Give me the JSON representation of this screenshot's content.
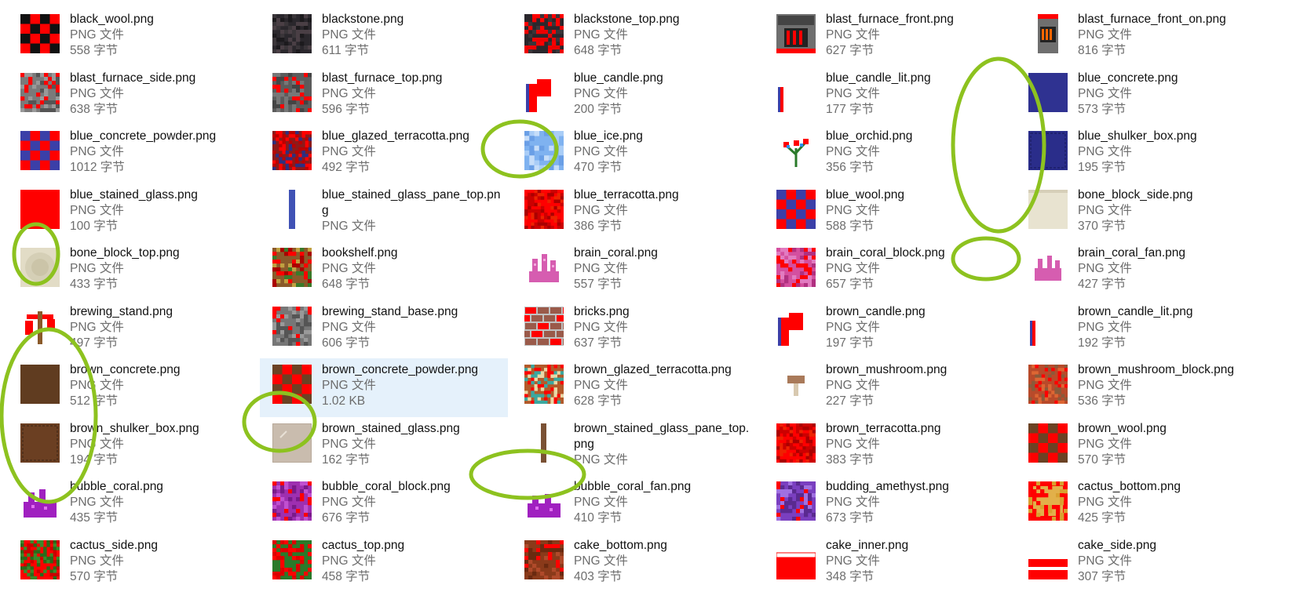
{
  "files": [
    {
      "name": "black_wool.png",
      "type": "PNG 文件",
      "size": "558 字节",
      "icon": "checker-red-black-texture"
    },
    {
      "name": "blackstone.png",
      "type": "PNG 文件",
      "size": "611 字节",
      "icon": "dark-stone-texture"
    },
    {
      "name": "blackstone_top.png",
      "type": "PNG 文件",
      "size": "648 字节",
      "icon": "dark-stone-red-texture"
    },
    {
      "name": "blast_furnace_front.png",
      "type": "PNG 文件",
      "size": "627 字节",
      "icon": "furnace-front-texture"
    },
    {
      "name": "blast_furnace_front_on.png",
      "type": "PNG 文件",
      "size": "816 字节",
      "icon": "furnace-front-on-texture"
    },
    {
      "name": "blast_furnace_side.png",
      "type": "PNG 文件",
      "size": "638 字节",
      "icon": "furnace-side-texture"
    },
    {
      "name": "blast_furnace_top.png",
      "type": "PNG 文件",
      "size": "596 字节",
      "icon": "furnace-top-texture"
    },
    {
      "name": "blue_candle.png",
      "type": "PNG 文件",
      "size": "200 字节",
      "icon": "candle-texture"
    },
    {
      "name": "blue_candle_lit.png",
      "type": "PNG 文件",
      "size": "177 字节",
      "icon": "candle-lit-texture"
    },
    {
      "name": "blue_concrete.png",
      "type": "PNG 文件",
      "size": "573 字节",
      "icon": "solid-blue-texture"
    },
    {
      "name": "blue_concrete_powder.png",
      "type": "PNG 文件",
      "size": "1012 字节",
      "icon": "checker-red-blue-texture"
    },
    {
      "name": "blue_glazed_terracotta.png",
      "type": "PNG 文件",
      "size": "492 字节",
      "icon": "glazed-terracotta-texture"
    },
    {
      "name": "blue_ice.png",
      "type": "PNG 文件",
      "size": "470 字节",
      "icon": "ice-texture"
    },
    {
      "name": "blue_orchid.png",
      "type": "PNG 文件",
      "size": "356 字节",
      "icon": "flower-texture"
    },
    {
      "name": "blue_shulker_box.png",
      "type": "PNG 文件",
      "size": "195 字节",
      "icon": "shulker-blue-texture"
    },
    {
      "name": "blue_stained_glass.png",
      "type": "PNG 文件",
      "size": "100 字节",
      "icon": "solid-red-texture"
    },
    {
      "name": "blue_stained_glass_pane_top.png",
      "type": "PNG 文件",
      "size": "",
      "icon": "glass-pane-blue-texture"
    },
    {
      "name": "blue_terracotta.png",
      "type": "PNG 文件",
      "size": "386 字节",
      "icon": "noise-red-texture"
    },
    {
      "name": "blue_wool.png",
      "type": "PNG 文件",
      "size": "588 字节",
      "icon": "checker-red-blue-texture"
    },
    {
      "name": "bone_block_side.png",
      "type": "PNG 文件",
      "size": "370 字节",
      "icon": "bone-side-texture"
    },
    {
      "name": "bone_block_top.png",
      "type": "PNG 文件",
      "size": "433 字节",
      "icon": "bone-top-texture"
    },
    {
      "name": "bookshelf.png",
      "type": "PNG 文件",
      "size": "648 字节",
      "icon": "bookshelf-texture"
    },
    {
      "name": "brain_coral.png",
      "type": "PNG 文件",
      "size": "557 字节",
      "icon": "coral-pink-texture"
    },
    {
      "name": "brain_coral_block.png",
      "type": "PNG 文件",
      "size": "657 字节",
      "icon": "coral-block-pink-texture"
    },
    {
      "name": "brain_coral_fan.png",
      "type": "PNG 文件",
      "size": "427 字节",
      "icon": "coral-fan-pink-texture"
    },
    {
      "name": "brewing_stand.png",
      "type": "PNG 文件",
      "size": "497 字节",
      "icon": "brewing-stand-texture"
    },
    {
      "name": "brewing_stand_base.png",
      "type": "PNG 文件",
      "size": "606 字节",
      "icon": "stone-red-texture"
    },
    {
      "name": "bricks.png",
      "type": "PNG 文件",
      "size": "637 字节",
      "icon": "bricks-texture"
    },
    {
      "name": "brown_candle.png",
      "type": "PNG 文件",
      "size": "197 字节",
      "icon": "candle-texture"
    },
    {
      "name": "brown_candle_lit.png",
      "type": "PNG 文件",
      "size": "192 字节",
      "icon": "candle-lit-texture"
    },
    {
      "name": "brown_concrete.png",
      "type": "PNG 文件",
      "size": "512 字节",
      "icon": "solid-brown-texture"
    },
    {
      "name": "brown_concrete_powder.png",
      "type": "PNG 文件",
      "size": "1.02 KB",
      "icon": "checker-red-brown-texture"
    },
    {
      "name": "brown_glazed_terracotta.png",
      "type": "PNG 文件",
      "size": "628 字节",
      "icon": "glazed-brown-texture"
    },
    {
      "name": "brown_mushroom.png",
      "type": "PNG 文件",
      "size": "227 字节",
      "icon": "mushroom-texture"
    },
    {
      "name": "brown_mushroom_block.png",
      "type": "PNG 文件",
      "size": "536 字节",
      "icon": "noise-red-brown-texture"
    },
    {
      "name": "brown_shulker_box.png",
      "type": "PNG 文件",
      "size": "194 字节",
      "icon": "shulker-brown-texture"
    },
    {
      "name": "brown_stained_glass.png",
      "type": "PNG 文件",
      "size": "162 字节",
      "icon": "glass-beige-texture"
    },
    {
      "name": "brown_stained_glass_pane_top.png",
      "type": "PNG 文件",
      "size": "",
      "icon": "glass-pane-brown-texture"
    },
    {
      "name": "brown_terracotta.png",
      "type": "PNG 文件",
      "size": "383 字节",
      "icon": "noise-red-texture"
    },
    {
      "name": "brown_wool.png",
      "type": "PNG 文件",
      "size": "570 字节",
      "icon": "checker-red-brown-texture"
    },
    {
      "name": "bubble_coral.png",
      "type": "PNG 文件",
      "size": "435 字节",
      "icon": "coral-purple-texture"
    },
    {
      "name": "bubble_coral_block.png",
      "type": "PNG 文件",
      "size": "676 字节",
      "icon": "coral-block-purple-texture"
    },
    {
      "name": "bubble_coral_fan.png",
      "type": "PNG 文件",
      "size": "410 字节",
      "icon": "coral-fan-purple-texture"
    },
    {
      "name": "budding_amethyst.png",
      "type": "PNG 文件",
      "size": "673 字节",
      "icon": "amethyst-texture"
    },
    {
      "name": "cactus_bottom.png",
      "type": "PNG 文件",
      "size": "425 字节",
      "icon": "cactus-bottom-texture"
    },
    {
      "name": "cactus_side.png",
      "type": "PNG 文件",
      "size": "570 字节",
      "icon": "cactus-side-texture"
    },
    {
      "name": "cactus_top.png",
      "type": "PNG 文件",
      "size": "458 字节",
      "icon": "cactus-top-texture"
    },
    {
      "name": "cake_bottom.png",
      "type": "PNG 文件",
      "size": "403 字节",
      "icon": "cake-bottom-texture"
    },
    {
      "name": "cake_inner.png",
      "type": "PNG 文件",
      "size": "348 字节",
      "icon": "cake-inner-texture"
    },
    {
      "name": "cake_side.png",
      "type": "PNG 文件",
      "size": "307 字节",
      "icon": "cake-side-texture"
    }
  ],
  "selected_file": "brown_concrete_powder.png",
  "annotation_color": "#8dc21f"
}
